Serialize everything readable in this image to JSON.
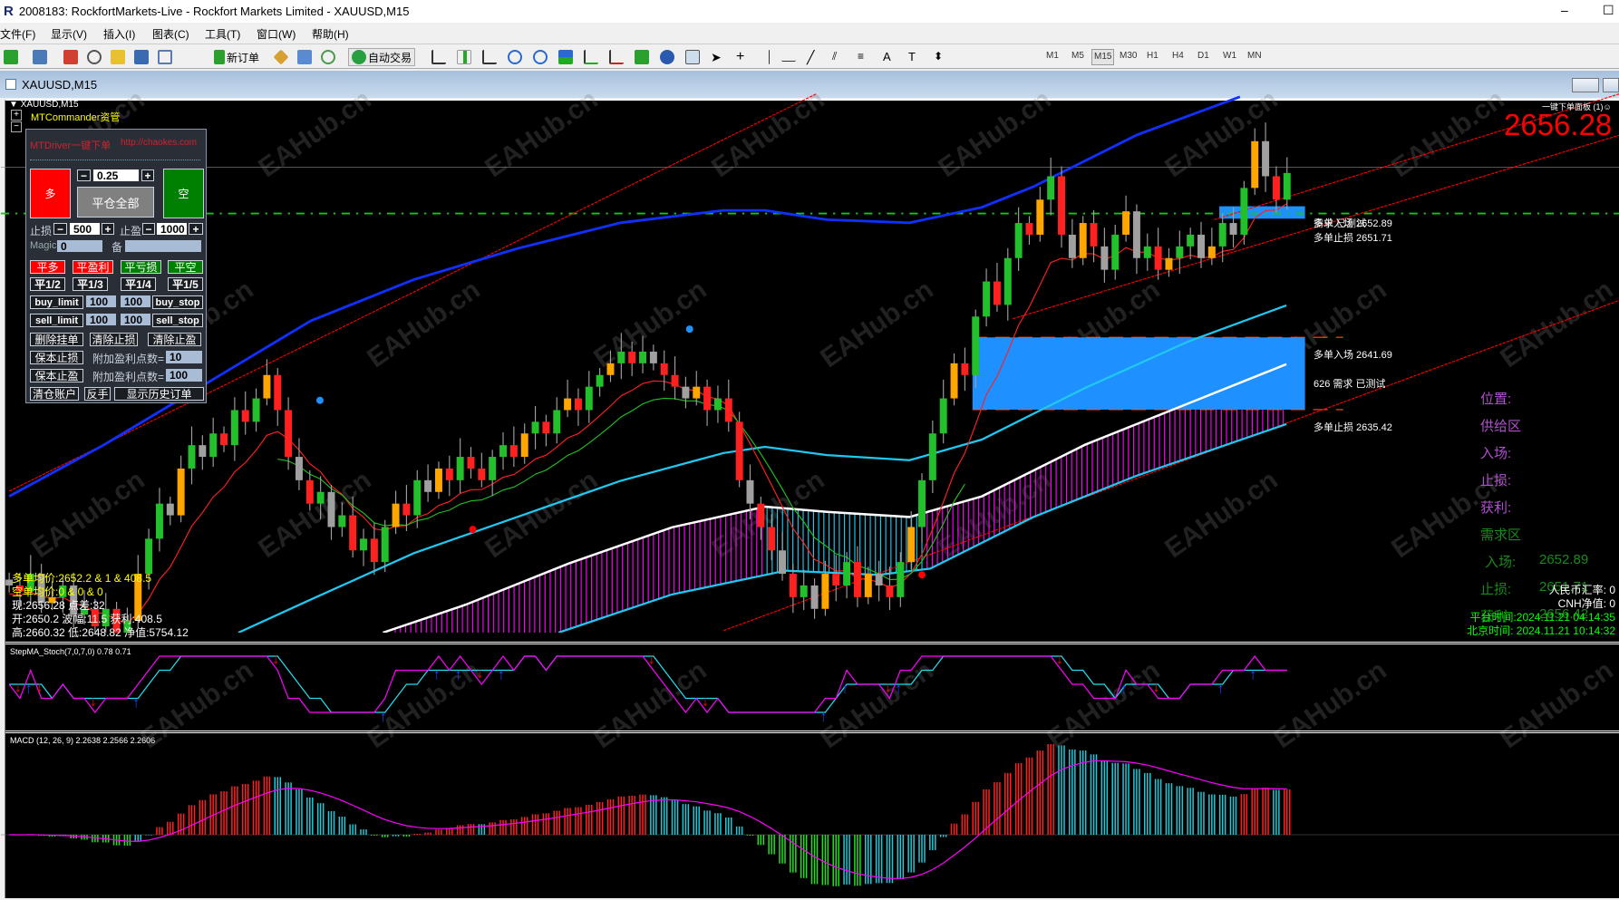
{
  "window": {
    "title": "2008183: RockfortMarkets-Live - Rockfort Markets Limited - XAUUSD,M15",
    "minimize": "–",
    "maximize": "☐"
  },
  "menu": [
    "文件(F)",
    "显示(V)",
    "插入(I)",
    "图表(C)",
    "工具(T)",
    "窗口(W)",
    "帮助(H)"
  ],
  "toolbar": {
    "new_order": "新订单",
    "auto_trading": "自动交易",
    "timeframes": [
      "M1",
      "M5",
      "M15",
      "M30",
      "H1",
      "H4",
      "D1",
      "W1",
      "MN"
    ],
    "active_timeframe": "M15"
  },
  "child_window": {
    "title": "XAUUSD,M15"
  },
  "chart": {
    "symbol_label": "XAUUSD,M15",
    "commander_label": "MTCommander资管",
    "panel_title": "一键下单面板 (1)☺",
    "current_price": "2656.28",
    "watermark": "EAHub.cn",
    "zone_labels": {
      "entry_top": "多单入场 2652.89",
      "demand_top": "需求 已测试",
      "stop_top": "多单止损 2651.71",
      "entry_main": "多单入场 2641.69",
      "demand_main": "626 需求 已测试",
      "stop_main": "多单止损 2635.42"
    },
    "stats": {
      "long_avg": "多单均价:2652.2 & 1 & 408.5",
      "short_avg": "空单均价:0 & 0 & 0",
      "now": "现:2656.28 点差:32",
      "open": "开:2650.2 波幅:11.5 获利:408.5",
      "high_low": "高:2660.32   低:2648.82 净值:5754.12"
    },
    "info": {
      "position": "位置:",
      "supply": "供给区",
      "supply_entry": "入场:",
      "supply_stop": "止损:",
      "supply_tp": "获利:",
      "demand": "需求区",
      "demand_entry_label": "入场:",
      "demand_entry": "2652.89",
      "demand_stop_label": "止损:",
      "demand_stop": "2651.71",
      "demand_tp_label": "获利:",
      "demand_tp": "2656.42",
      "cny_rate": "人民币汇率: 0",
      "cnh_equity": "CNH净值: 0",
      "platform_time": "平台时间:2024.11.21 04:14:35",
      "beijing_time": "北京时间: 2024.11.21 10:14:32"
    }
  },
  "order_panel": {
    "title": "MTDriver一键下单",
    "url": "http://chaokes.com",
    "buy": "多",
    "sell": "空",
    "lots": "0.25",
    "close_all": "平仓全部",
    "minus": "−",
    "plus": "+",
    "sl_label": "止损",
    "sl": "500",
    "tp_label": "止盈",
    "tp": "1000",
    "magic_label": "Magic",
    "magic": "0",
    "note_label": "备",
    "note": "",
    "close_buy": "平多",
    "close_profit": "平盈利",
    "close_loss": "平亏损",
    "close_sell": "平空",
    "half": "平1/2",
    "third": "平1/3",
    "quarter": "平1/4",
    "fifth": "平1/5",
    "buy_limit": "buy_limit",
    "buy_limit_val": "100",
    "buy_stop_val": "100",
    "buy_stop": "buy_stop",
    "sell_limit": "sell_limit",
    "sell_limit_val": "100",
    "sell_stop_val": "100",
    "sell_stop": "sell_stop",
    "delete_pending": "删除挂单",
    "clear_sl": "清除止损",
    "clear_tp": "清除止盈",
    "breakeven_sl": "保本止损",
    "extra_points_label": "附加盈利点数=",
    "extra_points_1": "10",
    "breakeven_tp": "保本止盈",
    "extra_points_2": "100",
    "close_account": "清仓账户",
    "reverse": "反手",
    "show_history": "显示历史订单"
  },
  "indicators": {
    "stoch_label": "StepMA_Stoch(7,0,7,0) 0.78 0.71",
    "macd_label": "MACD (12, 26, 9)  2.2638 2.2566 2.2606"
  },
  "colors": {
    "bull": "#22c02a",
    "bear": "#ff2020",
    "band_blue": "#1030ff",
    "cyan": "#20c8f0",
    "zone": "#1e90ff",
    "magenta": "#ff00ff",
    "price_red": "#ff0000",
    "info_purple": "#b050d0",
    "info_green": "#1a8a1a"
  },
  "chart_data": {
    "type": "candlestick",
    "symbol": "XAUUSD",
    "timeframe": "M15",
    "ylim": [
      2617,
      2663
    ],
    "close": [
      2621,
      2620.5,
      2622,
      2619.5,
      2620,
      2621,
      2618.5,
      2619,
      2617.5,
      2619,
      2616.5,
      2618,
      2622,
      2625,
      2628,
      2627,
      2631,
      2633,
      2632,
      2634,
      2633,
      2636,
      2635,
      2637,
      2639,
      2636,
      2632,
      2630,
      2628,
      2629,
      2626,
      2627,
      2624,
      2625,
      2623,
      2626,
      2628,
      2627,
      2630,
      2629,
      2631,
      2630,
      2632,
      2631,
      2630,
      2632,
      2633,
      2632,
      2634,
      2635,
      2634,
      2636,
      2637,
      2636,
      2638,
      2639,
      2640,
      2641,
      2640,
      2641,
      2640,
      2639,
      2638,
      2637,
      2638,
      2636,
      2637,
      2635,
      2630,
      2628,
      2626,
      2624,
      2622,
      2620,
      2621,
      2619,
      2622,
      2621,
      2623,
      2620,
      2622,
      2621,
      2620,
      2623,
      2626,
      2630,
      2634,
      2637,
      2640,
      2639,
      2644,
      2647,
      2645,
      2649,
      2652,
      2651,
      2654,
      2656,
      2651,
      2649,
      2652,
      2650,
      2648,
      2651,
      2653,
      2649,
      2650,
      2648,
      2649,
      2650,
      2651,
      2649,
      2650,
      2652,
      2651,
      2655,
      2659,
      2656,
      2654,
      2656.28
    ],
    "levels": {
      "long_entry": 2652.89,
      "long_stop": 2651.71,
      "zone_entry": 2641.69,
      "zone_stop": 2635.42
    }
  }
}
